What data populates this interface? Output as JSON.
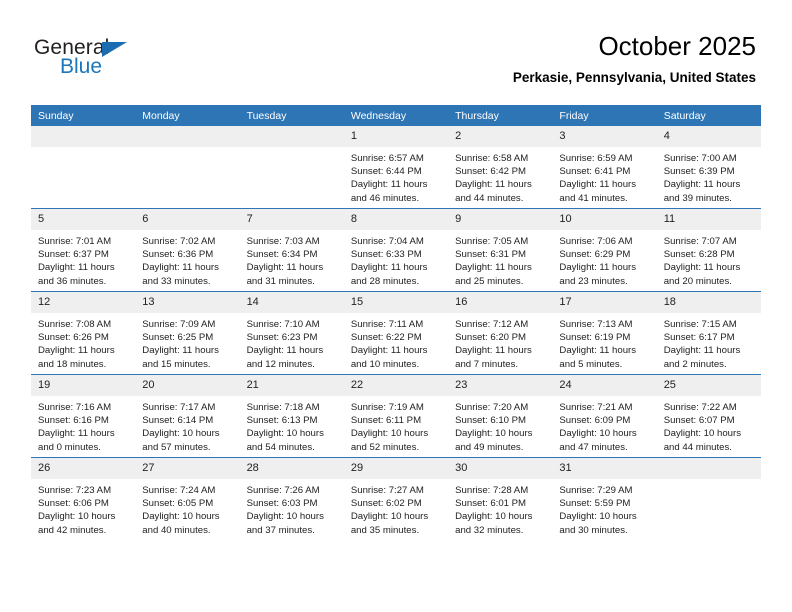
{
  "brand": {
    "name_top": "General",
    "name_bottom": "Blue",
    "color_black": "#231f20",
    "color_blue": "#1c76bc"
  },
  "header": {
    "title": "October 2025",
    "subtitle": "Perkasie, Pennsylvania, United States"
  },
  "theme": {
    "header_blue": "#2e75b6",
    "daynum_gray": "#efefef",
    "text": "#222222"
  },
  "weekdays": [
    "Sunday",
    "Monday",
    "Tuesday",
    "Wednesday",
    "Thursday",
    "Friday",
    "Saturday"
  ],
  "weeks": [
    [
      {
        "day": "",
        "sunrise": "",
        "sunset": "",
        "daylight1": "",
        "daylight2": ""
      },
      {
        "day": "",
        "sunrise": "",
        "sunset": "",
        "daylight1": "",
        "daylight2": ""
      },
      {
        "day": "",
        "sunrise": "",
        "sunset": "",
        "daylight1": "",
        "daylight2": ""
      },
      {
        "day": "1",
        "sunrise": "Sunrise: 6:57 AM",
        "sunset": "Sunset: 6:44 PM",
        "daylight1": "Daylight: 11 hours",
        "daylight2": "and 46 minutes."
      },
      {
        "day": "2",
        "sunrise": "Sunrise: 6:58 AM",
        "sunset": "Sunset: 6:42 PM",
        "daylight1": "Daylight: 11 hours",
        "daylight2": "and 44 minutes."
      },
      {
        "day": "3",
        "sunrise": "Sunrise: 6:59 AM",
        "sunset": "Sunset: 6:41 PM",
        "daylight1": "Daylight: 11 hours",
        "daylight2": "and 41 minutes."
      },
      {
        "day": "4",
        "sunrise": "Sunrise: 7:00 AM",
        "sunset": "Sunset: 6:39 PM",
        "daylight1": "Daylight: 11 hours",
        "daylight2": "and 39 minutes."
      }
    ],
    [
      {
        "day": "5",
        "sunrise": "Sunrise: 7:01 AM",
        "sunset": "Sunset: 6:37 PM",
        "daylight1": "Daylight: 11 hours",
        "daylight2": "and 36 minutes."
      },
      {
        "day": "6",
        "sunrise": "Sunrise: 7:02 AM",
        "sunset": "Sunset: 6:36 PM",
        "daylight1": "Daylight: 11 hours",
        "daylight2": "and 33 minutes."
      },
      {
        "day": "7",
        "sunrise": "Sunrise: 7:03 AM",
        "sunset": "Sunset: 6:34 PM",
        "daylight1": "Daylight: 11 hours",
        "daylight2": "and 31 minutes."
      },
      {
        "day": "8",
        "sunrise": "Sunrise: 7:04 AM",
        "sunset": "Sunset: 6:33 PM",
        "daylight1": "Daylight: 11 hours",
        "daylight2": "and 28 minutes."
      },
      {
        "day": "9",
        "sunrise": "Sunrise: 7:05 AM",
        "sunset": "Sunset: 6:31 PM",
        "daylight1": "Daylight: 11 hours",
        "daylight2": "and 25 minutes."
      },
      {
        "day": "10",
        "sunrise": "Sunrise: 7:06 AM",
        "sunset": "Sunset: 6:29 PM",
        "daylight1": "Daylight: 11 hours",
        "daylight2": "and 23 minutes."
      },
      {
        "day": "11",
        "sunrise": "Sunrise: 7:07 AM",
        "sunset": "Sunset: 6:28 PM",
        "daylight1": "Daylight: 11 hours",
        "daylight2": "and 20 minutes."
      }
    ],
    [
      {
        "day": "12",
        "sunrise": "Sunrise: 7:08 AM",
        "sunset": "Sunset: 6:26 PM",
        "daylight1": "Daylight: 11 hours",
        "daylight2": "and 18 minutes."
      },
      {
        "day": "13",
        "sunrise": "Sunrise: 7:09 AM",
        "sunset": "Sunset: 6:25 PM",
        "daylight1": "Daylight: 11 hours",
        "daylight2": "and 15 minutes."
      },
      {
        "day": "14",
        "sunrise": "Sunrise: 7:10 AM",
        "sunset": "Sunset: 6:23 PM",
        "daylight1": "Daylight: 11 hours",
        "daylight2": "and 12 minutes."
      },
      {
        "day": "15",
        "sunrise": "Sunrise: 7:11 AM",
        "sunset": "Sunset: 6:22 PM",
        "daylight1": "Daylight: 11 hours",
        "daylight2": "and 10 minutes."
      },
      {
        "day": "16",
        "sunrise": "Sunrise: 7:12 AM",
        "sunset": "Sunset: 6:20 PM",
        "daylight1": "Daylight: 11 hours",
        "daylight2": "and 7 minutes."
      },
      {
        "day": "17",
        "sunrise": "Sunrise: 7:13 AM",
        "sunset": "Sunset: 6:19 PM",
        "daylight1": "Daylight: 11 hours",
        "daylight2": "and 5 minutes."
      },
      {
        "day": "18",
        "sunrise": "Sunrise: 7:15 AM",
        "sunset": "Sunset: 6:17 PM",
        "daylight1": "Daylight: 11 hours",
        "daylight2": "and 2 minutes."
      }
    ],
    [
      {
        "day": "19",
        "sunrise": "Sunrise: 7:16 AM",
        "sunset": "Sunset: 6:16 PM",
        "daylight1": "Daylight: 11 hours",
        "daylight2": "and 0 minutes."
      },
      {
        "day": "20",
        "sunrise": "Sunrise: 7:17 AM",
        "sunset": "Sunset: 6:14 PM",
        "daylight1": "Daylight: 10 hours",
        "daylight2": "and 57 minutes."
      },
      {
        "day": "21",
        "sunrise": "Sunrise: 7:18 AM",
        "sunset": "Sunset: 6:13 PM",
        "daylight1": "Daylight: 10 hours",
        "daylight2": "and 54 minutes."
      },
      {
        "day": "22",
        "sunrise": "Sunrise: 7:19 AM",
        "sunset": "Sunset: 6:11 PM",
        "daylight1": "Daylight: 10 hours",
        "daylight2": "and 52 minutes."
      },
      {
        "day": "23",
        "sunrise": "Sunrise: 7:20 AM",
        "sunset": "Sunset: 6:10 PM",
        "daylight1": "Daylight: 10 hours",
        "daylight2": "and 49 minutes."
      },
      {
        "day": "24",
        "sunrise": "Sunrise: 7:21 AM",
        "sunset": "Sunset: 6:09 PM",
        "daylight1": "Daylight: 10 hours",
        "daylight2": "and 47 minutes."
      },
      {
        "day": "25",
        "sunrise": "Sunrise: 7:22 AM",
        "sunset": "Sunset: 6:07 PM",
        "daylight1": "Daylight: 10 hours",
        "daylight2": "and 44 minutes."
      }
    ],
    [
      {
        "day": "26",
        "sunrise": "Sunrise: 7:23 AM",
        "sunset": "Sunset: 6:06 PM",
        "daylight1": "Daylight: 10 hours",
        "daylight2": "and 42 minutes."
      },
      {
        "day": "27",
        "sunrise": "Sunrise: 7:24 AM",
        "sunset": "Sunset: 6:05 PM",
        "daylight1": "Daylight: 10 hours",
        "daylight2": "and 40 minutes."
      },
      {
        "day": "28",
        "sunrise": "Sunrise: 7:26 AM",
        "sunset": "Sunset: 6:03 PM",
        "daylight1": "Daylight: 10 hours",
        "daylight2": "and 37 minutes."
      },
      {
        "day": "29",
        "sunrise": "Sunrise: 7:27 AM",
        "sunset": "Sunset: 6:02 PM",
        "daylight1": "Daylight: 10 hours",
        "daylight2": "and 35 minutes."
      },
      {
        "day": "30",
        "sunrise": "Sunrise: 7:28 AM",
        "sunset": "Sunset: 6:01 PM",
        "daylight1": "Daylight: 10 hours",
        "daylight2": "and 32 minutes."
      },
      {
        "day": "31",
        "sunrise": "Sunrise: 7:29 AM",
        "sunset": "Sunset: 5:59 PM",
        "daylight1": "Daylight: 10 hours",
        "daylight2": "and 30 minutes."
      },
      {
        "day": "",
        "sunrise": "",
        "sunset": "",
        "daylight1": "",
        "daylight2": ""
      }
    ]
  ]
}
